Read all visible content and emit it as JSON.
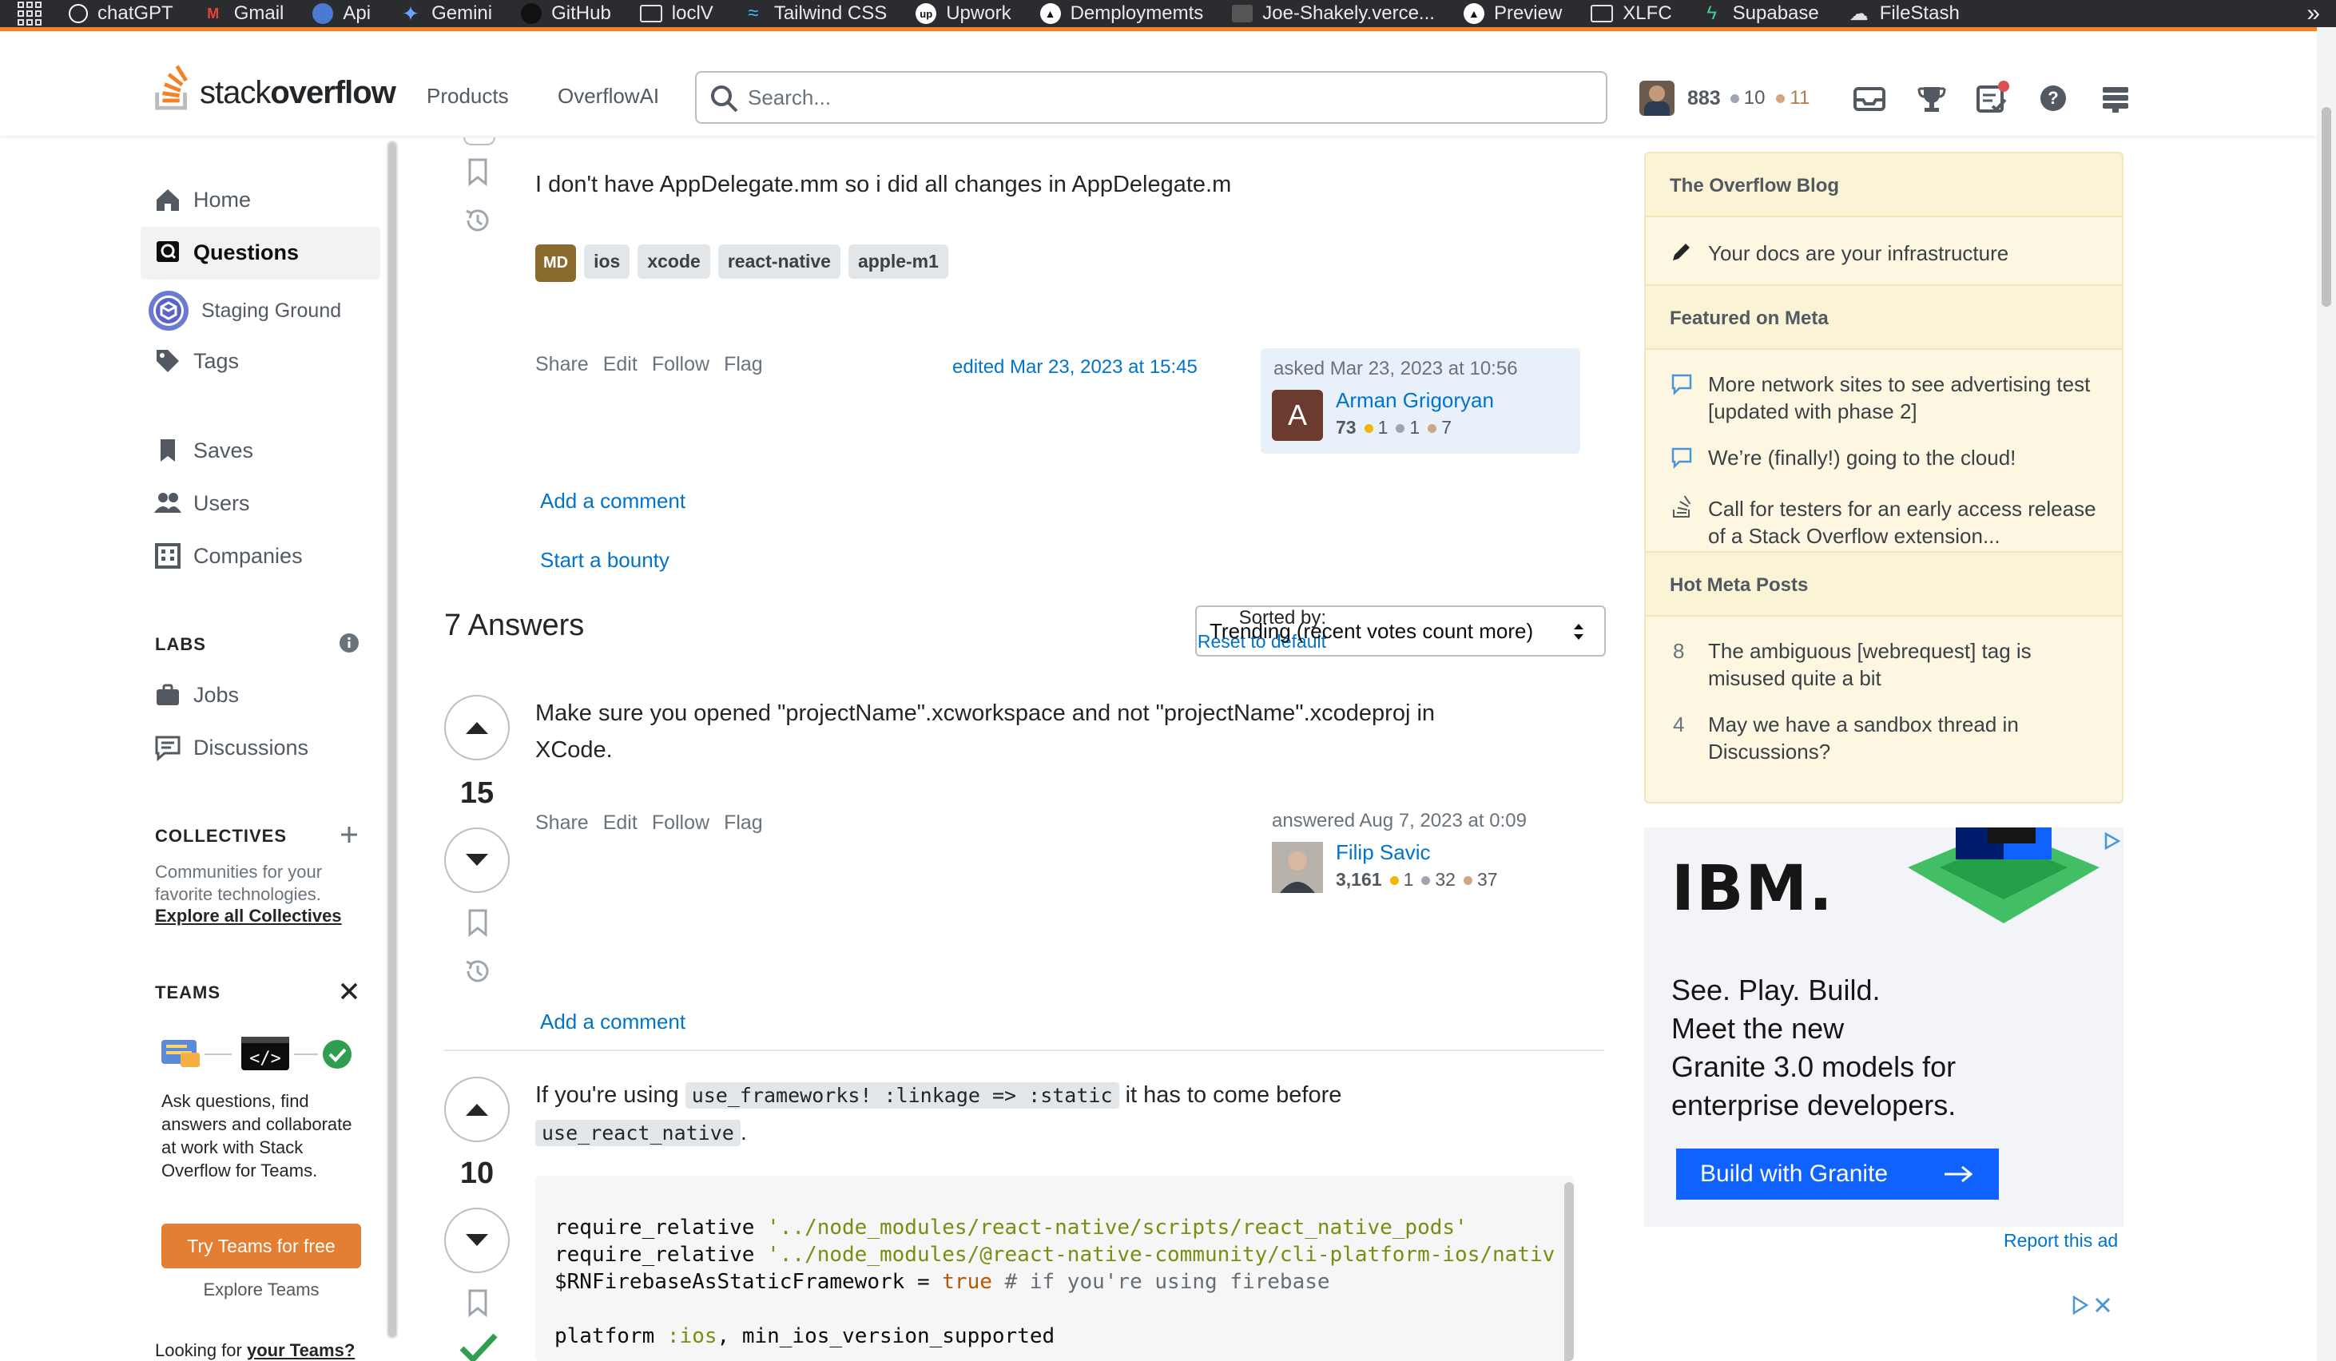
{
  "bookmarks": [
    {
      "label": "chatGPT",
      "icon": "openai-icon",
      "color": "#2b2c2f"
    },
    {
      "label": "Gmail",
      "icon": "gmail-icon",
      "color": "#ea4335"
    },
    {
      "label": "Api",
      "icon": "globe-icon",
      "color": "#4a7bd0"
    },
    {
      "label": "Gemini",
      "icon": "gemini-icon",
      "color": "#4a7bd0"
    },
    {
      "label": "GitHub",
      "icon": "github-icon",
      "color": "#2b2c2f"
    },
    {
      "label": "loclV",
      "icon": "folder-icon",
      "color": "#2b2c2f"
    },
    {
      "label": "Tailwind CSS",
      "icon": "tailwind-icon",
      "color": "#38bdf8"
    },
    {
      "label": "Upwork",
      "icon": "upwork-icon",
      "color": "#111"
    },
    {
      "label": "Demploymemts",
      "icon": "vercel-icon",
      "color": "#111"
    },
    {
      "label": "Joe-Shakely.verce...",
      "icon": "site-icon",
      "color": "#444"
    },
    {
      "label": "Preview",
      "icon": "vercel-icon",
      "color": "#111"
    },
    {
      "label": "XLFC",
      "icon": "folder-icon",
      "color": "#2b2c2f"
    },
    {
      "label": "Supabase",
      "icon": "supabase-icon",
      "color": "#3ecf8e"
    },
    {
      "label": "FileStash",
      "icon": "cloud-icon",
      "color": "#2b2c2f"
    }
  ],
  "header": {
    "logo_light": "stack",
    "logo_bold": "overflow",
    "nav": [
      "Products",
      "OverflowAI"
    ],
    "search_placeholder": "Search...",
    "user": {
      "reputation": "883",
      "silver": "10",
      "bronze": "11"
    }
  },
  "sidebar": {
    "items": [
      {
        "label": "Home",
        "icon": "home-icon"
      },
      {
        "label": "Questions",
        "icon": "questions-icon"
      },
      {
        "label": "Staging Ground",
        "icon": "staging-ground-icon"
      },
      {
        "label": "Tags",
        "icon": "tag-icon"
      },
      {
        "label": "Saves",
        "icon": "bookmark-icon"
      },
      {
        "label": "Users",
        "icon": "users-icon"
      },
      {
        "label": "Companies",
        "icon": "building-icon"
      }
    ],
    "labs_title": "LABS",
    "labs_items": [
      {
        "label": "Jobs",
        "icon": "briefcase-icon"
      },
      {
        "label": "Discussions",
        "icon": "discussions-icon"
      }
    ],
    "collectives_title": "COLLECTIVES",
    "collectives_text": "Communities for your favorite technologies.",
    "collectives_link": "Explore all Collectives",
    "teams_title": "TEAMS",
    "teams_text": "Ask questions, find answers and collaborate at work with Stack Overflow for Teams.",
    "teams_button": "Try Teams for free",
    "teams_explore": "Explore Teams",
    "teams_footer_prefix": "Looking for",
    "teams_footer_link": "your Teams?"
  },
  "question": {
    "body": "I don't have AppDelegate.mm so i did all changes in AppDelegate.m",
    "tags": [
      "ios",
      "xcode",
      "react-native",
      "apple-m1"
    ],
    "tag_badge": "MD",
    "actions": [
      "Share",
      "Edit",
      "Follow",
      "Flag"
    ],
    "edited": "edited Mar 23, 2023 at 15:45",
    "asked": "asked Mar 23, 2023 at 10:56",
    "author": {
      "initial": "A",
      "name": "Arman Grigoryan",
      "rep": "73",
      "gold": "1",
      "silver": "1",
      "bronze": "7"
    },
    "add_comment": "Add a comment",
    "bounty": "Start a bounty"
  },
  "answers_header": {
    "count_label": "7 Answers",
    "sorted_by": "Sorted by:",
    "reset": "Reset to default",
    "sort_value": "Trending (recent votes count more)"
  },
  "answers": [
    {
      "votes": "15",
      "body": "Make sure you opened \"projectName\".xcworkspace and not \"projectName\".xcodeproj in XCode.",
      "actions": [
        "Share",
        "Edit",
        "Follow",
        "Flag"
      ],
      "answered": "answered Aug 7, 2023 at 0:09",
      "author": {
        "name": "Filip Savic",
        "rep": "3,161",
        "gold": "1",
        "silver": "32",
        "bronze": "37"
      },
      "add_comment": "Add a comment"
    },
    {
      "votes": "10",
      "text_before": "If you're using",
      "code1": "use_frameworks! :linkage => :static",
      "text_middle": "it has to come before",
      "code2": "use_react_native",
      "text_after": ".",
      "code_lines": {
        "l1a": "require_relative ",
        "l1b": "'../node_modules/react-native/scripts/react_native_pods'",
        "l2a": "require_relative ",
        "l2b": "'../node_modules/@react-native-community/cli-platform-ios/nativ",
        "l3a": "$RNFirebaseAsStaticFramework = ",
        "l3b": "true",
        "l3c": " # if you're using firebase",
        "l4a": "platform ",
        "l4b": ":ios",
        "l4c": ", min_ios_version_supported"
      }
    }
  ],
  "widget": {
    "blog_title": "The Overflow Blog",
    "blog_items": [
      "Your docs are your infrastructure"
    ],
    "meta_title": "Featured on Meta",
    "meta_items": [
      "More network sites to see advertising test [updated with phase 2]",
      "We’re (finally!) going to the cloud!",
      "Call for testers for an early access release of a Stack Overflow extension..."
    ],
    "hot_title": "Hot Meta Posts",
    "hot_items": [
      {
        "count": "8",
        "text": "The ambiguous [webrequest] tag is misused quite a bit"
      },
      {
        "count": "4",
        "text": "May we have a sandbox thread in Discussions?"
      }
    ]
  },
  "ad": {
    "brand": "IBM.",
    "headline": "See. Play. Build. Meet the new Granite 3.0 models for enterprise developers.",
    "headline_lines": [
      "See. Play. Build.",
      "Meet the new",
      "Granite 3.0 models for",
      "enterprise developers."
    ],
    "cta": "Build with Granite",
    "report": "Report this ad"
  },
  "colors": {
    "accent": "#f48225",
    "link": "#0074cc",
    "blog_bg": "#fdf7e2",
    "ibm_blue": "#0f62fe"
  }
}
